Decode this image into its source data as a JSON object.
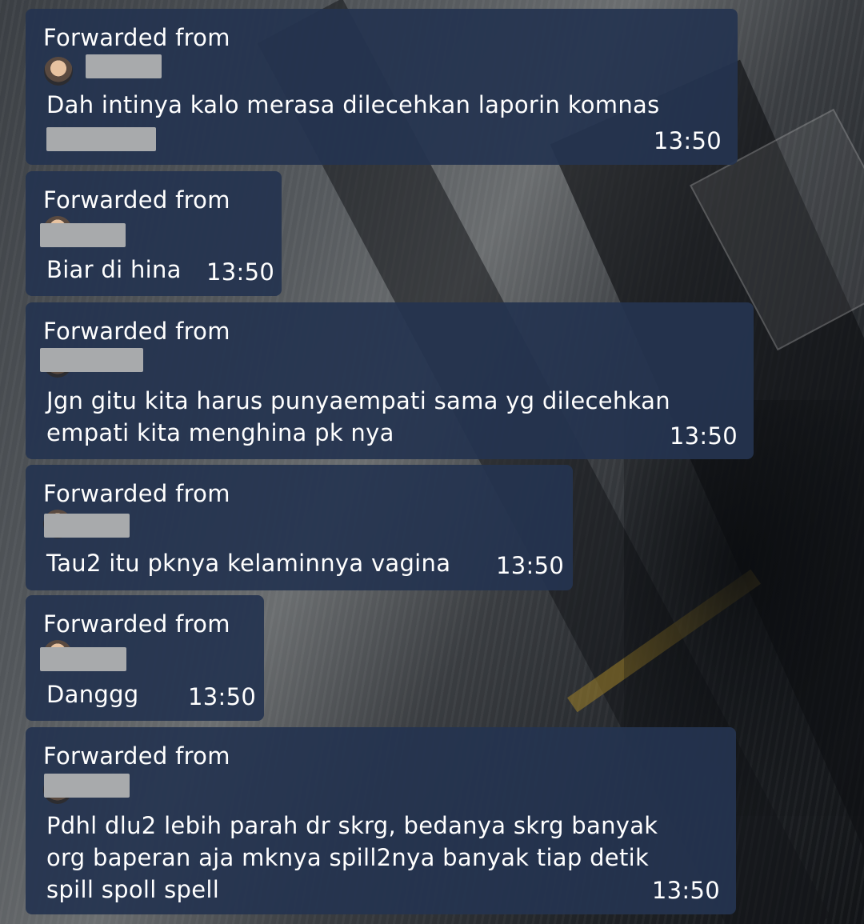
{
  "forward_label": "Forwarded from",
  "messages": [
    {
      "text": "Dah intinya kalo merasa dilecehkan laporin komnas",
      "time": "13:50"
    },
    {
      "text": "Biar di hina",
      "time": "13:50"
    },
    {
      "text": "Jgn gitu kita harus punyaempati sama yg dilecehkan\nempati kita menghina pk nya",
      "time": "13:50"
    },
    {
      "text": "Tau2 itu pknya kelaminnya vagina",
      "time": "13:50"
    },
    {
      "text": "Danggg",
      "time": "13:50"
    },
    {
      "text": "Pdhl dlu2 lebih parah dr skrg, bedanya skrg banyak\norg baperan aja mknya spill2nya banyak tiap detik\nspill spoll spell",
      "time": "13:50"
    }
  ],
  "colors": {
    "bubble": "#253450",
    "text": "#ffffff",
    "redaction": "#a8aaac"
  },
  "icons": {
    "avatar": "sender-avatar-icon"
  }
}
